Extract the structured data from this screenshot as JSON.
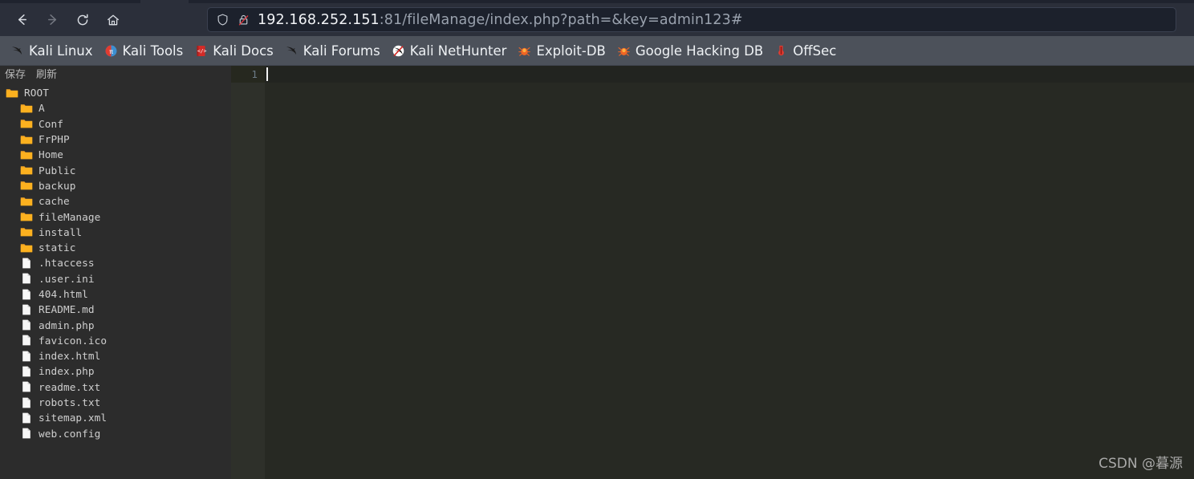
{
  "browser": {
    "nav": {
      "back": "Back",
      "forward": "Forward",
      "reload": "Reload",
      "home": "Home"
    },
    "urlbar": {
      "host": "192.168.252.151",
      "rest": ":81/fileManage/index.php?path=&key=admin123#",
      "full_url": "192.168.252.151:81/fileManage/index.php?path=&key=admin123#",
      "shield_icon": "shield-icon",
      "lock_icon": "lock-crossed-icon"
    },
    "bookmarks": [
      {
        "label": "Kali Linux",
        "icon": "kali-dragon-icon"
      },
      {
        "label": "Kali Tools",
        "icon": "kali-tools-icon"
      },
      {
        "label": "Kali Docs",
        "icon": "kali-docs-icon"
      },
      {
        "label": "Kali Forums",
        "icon": "kali-forums-icon"
      },
      {
        "label": "Kali NetHunter",
        "icon": "kali-nethunter-icon"
      },
      {
        "label": "Exploit-DB",
        "icon": "exploit-db-icon"
      },
      {
        "label": "Google Hacking DB",
        "icon": "google-hacking-db-icon"
      },
      {
        "label": "OffSec",
        "icon": "offsec-icon"
      }
    ]
  },
  "sidebar": {
    "actions": [
      {
        "label": "保存"
      },
      {
        "label": "刷新"
      }
    ],
    "tree": [
      {
        "label": "ROOT",
        "type": "folder",
        "depth": 0
      },
      {
        "label": "A",
        "type": "folder",
        "depth": 1
      },
      {
        "label": "Conf",
        "type": "folder",
        "depth": 1
      },
      {
        "label": "FrPHP",
        "type": "folder",
        "depth": 1
      },
      {
        "label": "Home",
        "type": "folder",
        "depth": 1
      },
      {
        "label": "Public",
        "type": "folder",
        "depth": 1
      },
      {
        "label": "backup",
        "type": "folder",
        "depth": 1
      },
      {
        "label": "cache",
        "type": "folder",
        "depth": 1
      },
      {
        "label": "fileManage",
        "type": "folder",
        "depth": 1
      },
      {
        "label": "install",
        "type": "folder",
        "depth": 1
      },
      {
        "label": "static",
        "type": "folder",
        "depth": 1
      },
      {
        "label": ".htaccess",
        "type": "file",
        "depth": 1
      },
      {
        "label": ".user.ini",
        "type": "file",
        "depth": 1
      },
      {
        "label": "404.html",
        "type": "file",
        "depth": 1
      },
      {
        "label": "README.md",
        "type": "file",
        "depth": 1
      },
      {
        "label": "admin.php",
        "type": "file",
        "depth": 1
      },
      {
        "label": "favicon.ico",
        "type": "file",
        "depth": 1
      },
      {
        "label": "index.html",
        "type": "file",
        "depth": 1
      },
      {
        "label": "index.php",
        "type": "file",
        "depth": 1
      },
      {
        "label": "readme.txt",
        "type": "file",
        "depth": 1
      },
      {
        "label": "robots.txt",
        "type": "file",
        "depth": 1
      },
      {
        "label": "sitemap.xml",
        "type": "file",
        "depth": 1
      },
      {
        "label": "web.config",
        "type": "file",
        "depth": 1
      }
    ]
  },
  "editor": {
    "line_numbers": [
      "1"
    ],
    "lines": [
      ""
    ]
  },
  "watermark": {
    "text": "CSDN @暮源"
  },
  "colors": {
    "folder": "#f5a623",
    "file": "#f2f2f2",
    "chrome": "#2b2f3a",
    "bookmarks_bar": "#4c515a",
    "sidebar": "#2c2c2c",
    "editor": "#272923",
    "gutter": "#2e302a",
    "accent_red": "#e03c31"
  }
}
